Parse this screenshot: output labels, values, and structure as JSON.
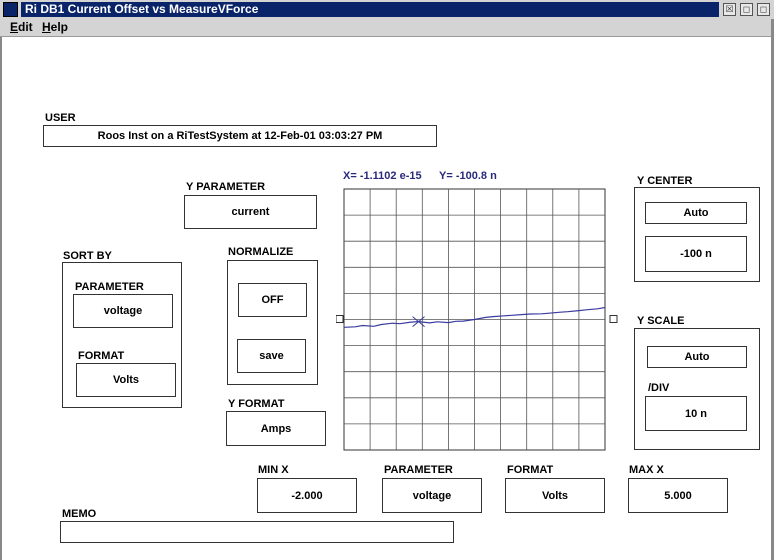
{
  "window": {
    "title": "Ri DB1 Current Offset vs MeasureVForce",
    "buttons": [
      "☒",
      "◻",
      "◻"
    ]
  },
  "menu": [
    {
      "first": "E",
      "rest": "dit"
    },
    {
      "first": "H",
      "rest": "elp"
    }
  ],
  "user": {
    "label": "USER",
    "value": "Roos Inst on a RiTestSystem at 12-Feb-01  03:03:27 PM"
  },
  "readout": {
    "x": "X= -1.1102 e-15",
    "y": "Y= -100.8 n"
  },
  "y_parameter": {
    "label": "Y PARAMETER",
    "value": "current"
  },
  "sort_by": {
    "label": "SORT BY",
    "parameter_label": "PARAMETER",
    "parameter_value": "voltage",
    "format_label": "FORMAT",
    "format_value": "Volts"
  },
  "normalize": {
    "label": "NORMALIZE",
    "state": "OFF",
    "save": "save"
  },
  "y_format": {
    "label": "Y FORMAT",
    "value": "Amps"
  },
  "y_center": {
    "label": "Y CENTER",
    "mode": "Auto",
    "value": "-100 n"
  },
  "y_scale": {
    "label": "Y SCALE",
    "mode": "Auto",
    "div_label": "/DIV",
    "div_value": "10 n"
  },
  "x_controls": {
    "min_x_label": "MIN X",
    "min_x_value": "-2.000",
    "parameter_label": "PARAMETER",
    "parameter_value": "voltage",
    "format_label": "FORMAT",
    "format_value": "Volts",
    "max_x_label": "MAX X",
    "max_x_value": "5.000"
  },
  "memo": {
    "label": "MEMO",
    "value": ""
  },
  "chart_data": {
    "type": "line",
    "xlim": [
      -2.0,
      5.0
    ],
    "ylim": [
      -150,
      -50
    ],
    "grid": true,
    "cursor": {
      "x": -1.1102e-15,
      "y": -100.8
    },
    "series": [
      {
        "color": "#3a3aa0",
        "x": [
          -2.0,
          -1.7,
          -1.5,
          -1.2,
          -1.0,
          -0.7,
          -0.5,
          -0.2,
          0.0,
          0.3,
          0.5,
          0.8,
          1.0,
          1.2,
          1.5,
          1.8,
          2.0,
          2.3,
          2.5,
          2.8,
          3.0,
          3.3,
          3.5,
          3.8,
          4.0,
          4.3,
          4.5,
          4.8,
          5.0
        ],
        "y": [
          -103.0,
          -102.8,
          -102.3,
          -102.6,
          -101.9,
          -101.4,
          -101.6,
          -101.0,
          -100.8,
          -101.3,
          -100.9,
          -101.2,
          -100.7,
          -100.6,
          -100.0,
          -99.2,
          -98.9,
          -98.6,
          -98.4,
          -98.1,
          -97.9,
          -97.8,
          -97.6,
          -97.2,
          -97.0,
          -96.6,
          -96.3,
          -95.9,
          -95.4
        ]
      }
    ]
  }
}
